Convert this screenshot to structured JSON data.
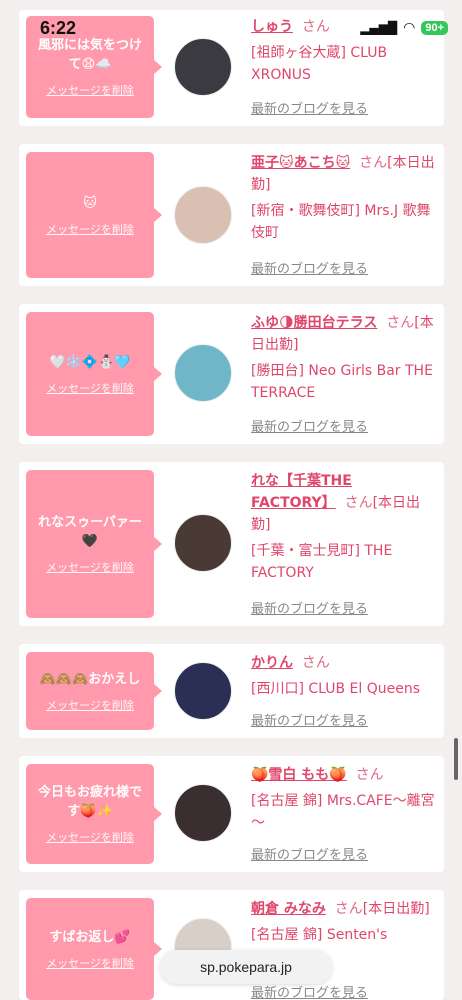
{
  "status": {
    "time": "6:22",
    "battery": "90+"
  },
  "url": "sp.pokepara.jp",
  "items": [
    {
      "msg": "風邪には気をつけて😧☁️",
      "del": "メッセージを削除",
      "name": "しゅう",
      "san": "さん",
      "status": "",
      "shop": "[祖師ヶ谷大蔵] CLUB XRONUS",
      "blog": "最新のブログを見る",
      "avatar": "#3a3a40"
    },
    {
      "msg": "🐱",
      "del": "メッセージを削除",
      "name": "亜子🐱あこち🐱",
      "san": "さん",
      "status": "[本日出勤]",
      "shop": "[新宿・歌舞伎町] Mrs.J 歌舞伎町",
      "blog": "最新のブログを見る",
      "avatar": "#d9c0b2"
    },
    {
      "msg": "🤍❄️💠⛄🩵",
      "del": "メッセージを削除",
      "name": "ふゆ🌗勝田台テラス",
      "san": "さん",
      "status": "[本日出勤]",
      "shop": "[勝田台] Neo Girls Bar THE TERRACE",
      "blog": "最新のブログを見る",
      "avatar": "#6fb6c9"
    },
    {
      "msg": "れなスゥーパァー🖤",
      "del": "メッセージを削除",
      "name": "れな【千葉THE FACTORY】",
      "san": "さん",
      "status": "[本日出勤]",
      "shop": "[千葉・富士見町] THE FACTORY",
      "blog": "最新のブログを見る",
      "avatar": "#4a3a36"
    },
    {
      "msg": "🙈🙈🙈おかえし",
      "del": "メッセージを削除",
      "name": "かりん",
      "san": "さん",
      "status": "",
      "shop": "[西川口] CLUB El Queens",
      "blog": "最新のブログを見る",
      "avatar": "#2b2f55"
    },
    {
      "msg": "今日もお疲れ様です🍑✨",
      "del": "メッセージを削除",
      "name": "🍑雪白 もも🍑",
      "san": "さん",
      "status": "",
      "shop": "[名古屋 錦] Mrs.CAFE～離宮～",
      "blog": "最新のブログを見る",
      "avatar": "#3b2e30"
    },
    {
      "msg": "すばお返し💕",
      "del": "メッセージを削除",
      "name": "朝倉 みなみ",
      "san": "さん",
      "status": "[本日出勤]",
      "shop": "[名古屋 錦] Senten's",
      "blog": "最新のブログを見る",
      "avatar": "#d8cfc8"
    }
  ]
}
